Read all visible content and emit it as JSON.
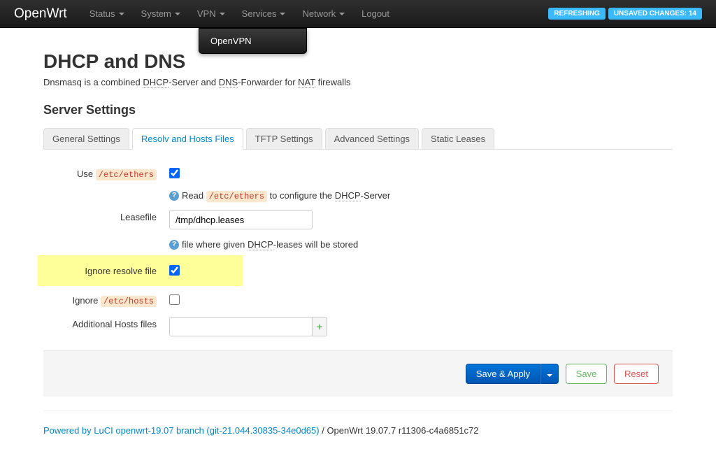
{
  "navbar": {
    "brand": "OpenWrt",
    "items": [
      "Status",
      "System",
      "VPN",
      "Services",
      "Network",
      "Logout"
    ],
    "dropdown_caret": [
      true,
      true,
      true,
      true,
      true,
      false
    ],
    "badges": {
      "refreshing": "REFRESHING",
      "unsaved": "UNSAVED CHANGES: 14"
    }
  },
  "dropdown": {
    "items": [
      "OpenVPN"
    ]
  },
  "page": {
    "title": "DHCP and DNS",
    "desc_prefix": "Dnsmasq is a combined ",
    "desc_dhcp": "DHCP",
    "desc_mid1": "-Server and ",
    "desc_dns": "DNS",
    "desc_mid2": "-Forwarder for ",
    "desc_nat": "NAT",
    "desc_suffix": " firewalls",
    "section_title": "Server Settings"
  },
  "tabs": {
    "items": [
      {
        "label": "General Settings",
        "active": false
      },
      {
        "label": "Resolv and Hosts Files",
        "active": true
      },
      {
        "label": "TFTP Settings",
        "active": false
      },
      {
        "label": "Advanced Settings",
        "active": false
      },
      {
        "label": "Static Leases",
        "active": false
      }
    ]
  },
  "form": {
    "use_ethers": {
      "label_prefix": "Use ",
      "label_code": "/etc/ethers",
      "checked": true,
      "hint_prefix": "Read ",
      "hint_code": "/etc/ethers",
      "hint_mid": " to configure the ",
      "hint_dhcp": "DHCP",
      "hint_suffix": "-Server"
    },
    "leasefile": {
      "label": "Leasefile",
      "value": "/tmp/dhcp.leases",
      "hint_prefix": "file where given ",
      "hint_dhcp": "DHCP",
      "hint_suffix": "-leases will be stored"
    },
    "ignore_resolve": {
      "label": "Ignore resolve file",
      "checked": true
    },
    "ignore_hosts": {
      "label_prefix": "Ignore ",
      "label_code": "/etc/hosts",
      "checked": false
    },
    "add_hosts": {
      "label": "Additional Hosts files",
      "value": ""
    }
  },
  "buttons": {
    "save_apply": "Save & Apply",
    "save": "Save",
    "reset": "Reset"
  },
  "footer": {
    "link": "Powered by LuCI openwrt-19.07 branch (git-21.044.30835-34e0d65)",
    "version": " / OpenWrt 19.07.7 r11306-c4a6851c72"
  }
}
